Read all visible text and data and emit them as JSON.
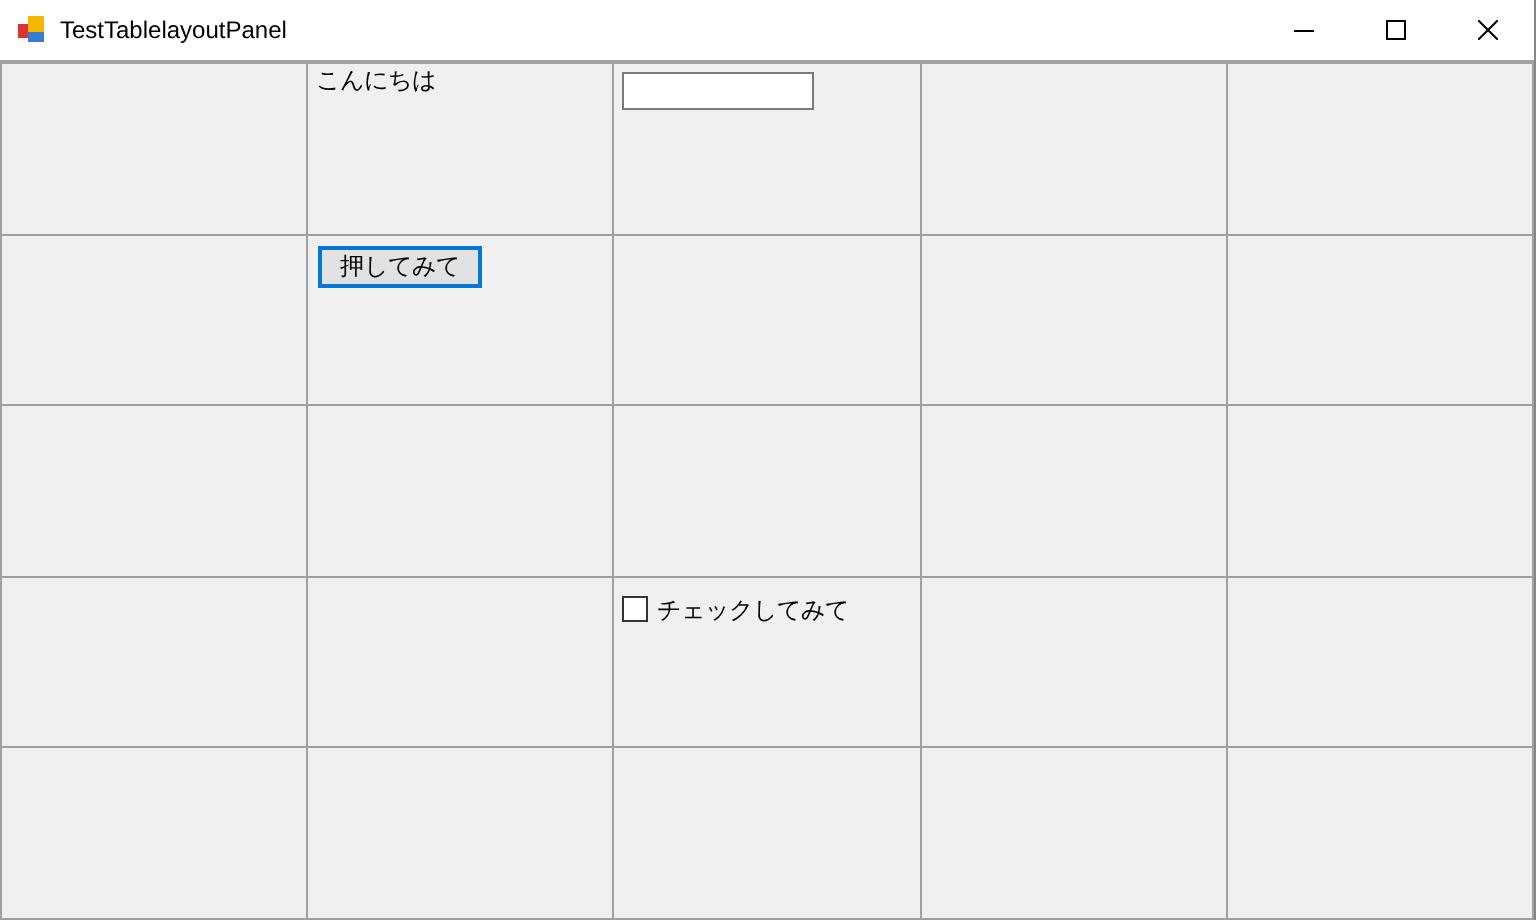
{
  "window": {
    "title": "TestTablelayoutPanel"
  },
  "table": {
    "rows": [
      [
        {
          "kind": "empty"
        },
        {
          "kind": "label",
          "text": "こんにちは"
        },
        {
          "kind": "textbox"
        },
        {
          "kind": "empty"
        },
        {
          "kind": "empty"
        }
      ],
      [
        {
          "kind": "empty"
        },
        {
          "kind": "button",
          "text": "押してみて",
          "focused": true
        },
        {
          "kind": "empty"
        },
        {
          "kind": "empty"
        },
        {
          "kind": "empty"
        }
      ],
      [
        {
          "kind": "empty"
        },
        {
          "kind": "empty"
        },
        {
          "kind": "empty"
        },
        {
          "kind": "empty"
        },
        {
          "kind": "empty"
        }
      ],
      [
        {
          "kind": "empty"
        },
        {
          "kind": "empty"
        },
        {
          "kind": "checkbox",
          "text": "チェックしてみて",
          "checked": false
        },
        {
          "kind": "empty"
        },
        {
          "kind": "empty"
        }
      ],
      [
        {
          "kind": "empty"
        },
        {
          "kind": "empty"
        },
        {
          "kind": "empty"
        },
        {
          "kind": "empty"
        },
        {
          "kind": "empty"
        }
      ]
    ]
  }
}
